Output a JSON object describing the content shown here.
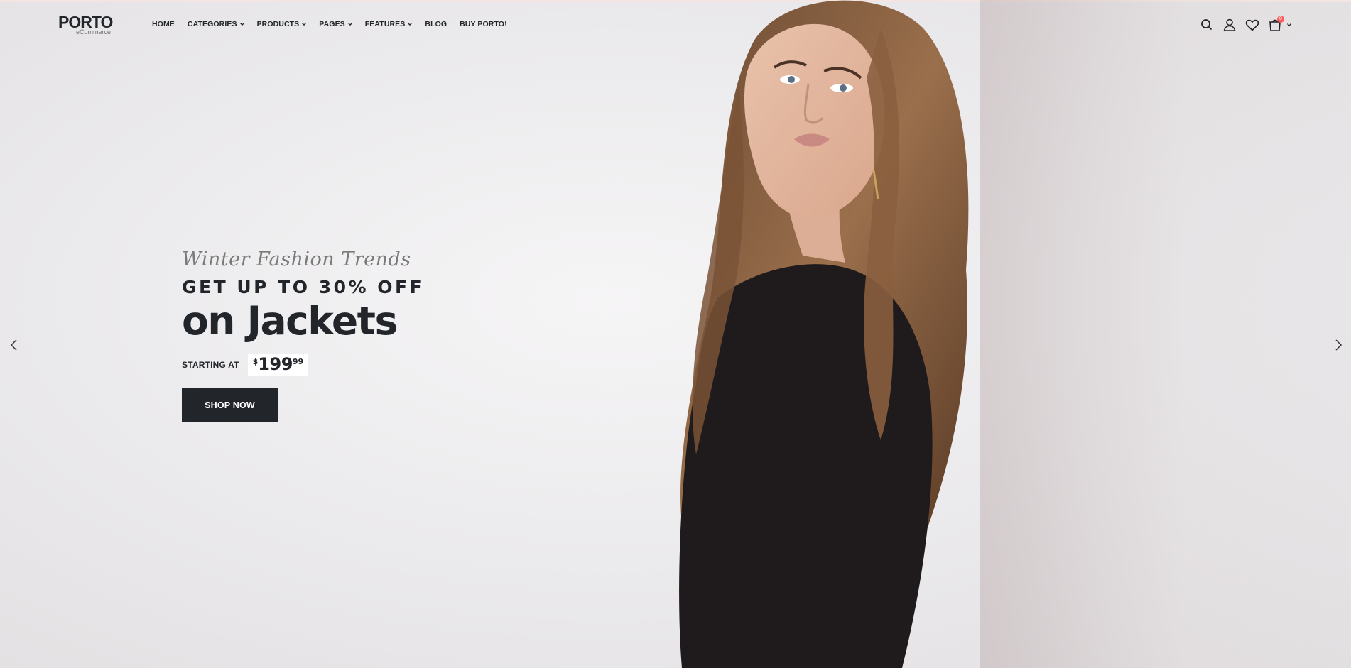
{
  "header": {
    "logo": "PORTO",
    "logo_sub": "eCommerce",
    "nav": [
      {
        "label": "HOME",
        "has_dropdown": false
      },
      {
        "label": "CATEGORIES",
        "has_dropdown": true
      },
      {
        "label": "PRODUCTS",
        "has_dropdown": true
      },
      {
        "label": "PAGES",
        "has_dropdown": true
      },
      {
        "label": "FEATURES",
        "has_dropdown": true
      },
      {
        "label": "BLOG",
        "has_dropdown": false
      },
      {
        "label": "BUY PORTO!",
        "has_dropdown": false
      }
    ],
    "icons": [
      "search-icon",
      "user-icon",
      "wishlist-heart-icon",
      "cart-bag-icon"
    ],
    "cart_count": "0"
  },
  "hero": {
    "script_text": "Winter Fashion Trends",
    "offer_text": "GET UP TO 30% OFF",
    "headline": "on Jackets",
    "starting_label": "STARTING AT",
    "price": {
      "currency": "$",
      "integer": "199",
      "decimal": "99"
    },
    "cta_label": "SHOP NOW"
  },
  "slider": {
    "prev_icon": "chevron-left-icon",
    "next_icon": "chevron-right-icon"
  },
  "colors": {
    "dark": "#222529",
    "badge": "#ff5b5b",
    "background": "#ece9ea"
  }
}
